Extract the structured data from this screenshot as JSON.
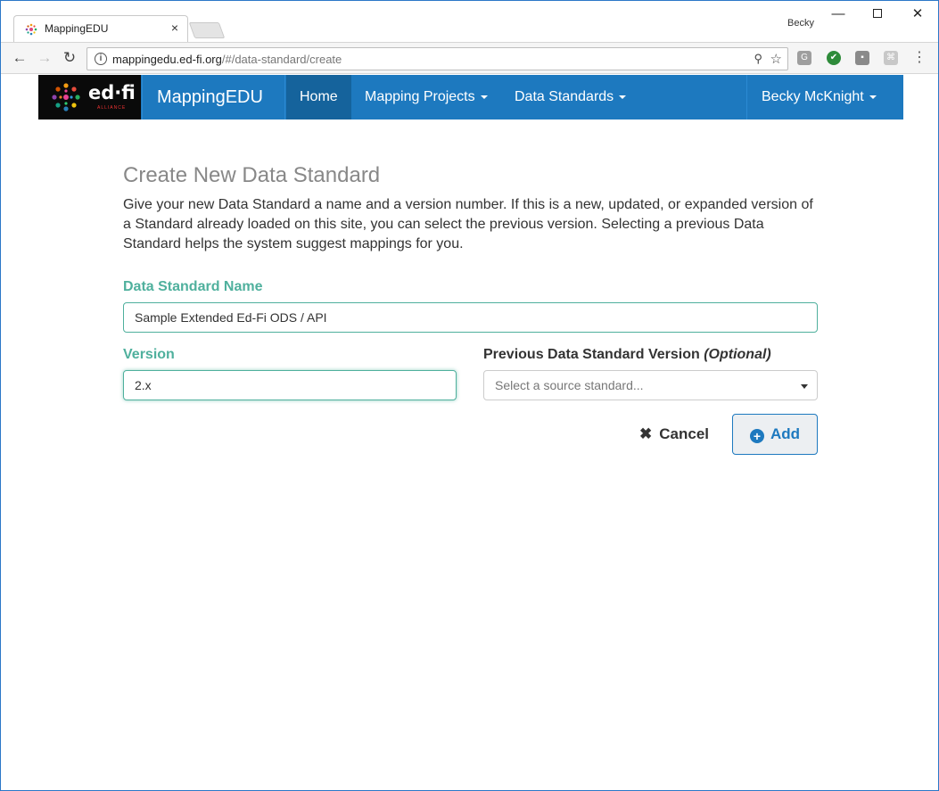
{
  "browser": {
    "tab_title": "MappingEDU",
    "tab_close": "×",
    "profile_name": "Becky",
    "url_host": "mappingedu.ed-fi.org",
    "url_path": "/#/data-standard/create",
    "extensions": [
      "G",
      "✔",
      "▪",
      "⌘"
    ]
  },
  "navbar": {
    "logo_text": "ed·fi",
    "logo_sub": "ALLIANCE",
    "brand": "MappingEDU",
    "home": "Home",
    "mapping_projects": "Mapping Projects",
    "data_standards": "Data Standards",
    "user": "Becky McKnight"
  },
  "page": {
    "title": "Create New Data Standard",
    "intro": "Give your new Data Standard a name and a version number. If this is a new, updated, or expanded version of a Standard already loaded on this site, you can select the previous version. Selecting a previous Data Standard helps the system suggest mappings for you."
  },
  "form": {
    "name_label": "Data Standard Name",
    "name_value": "Sample Extended Ed-Fi ODS / API",
    "version_label": "Version",
    "version_value": "2.x",
    "prev_label": "Previous Data Standard Version ",
    "prev_optional": "(Optional)",
    "prev_placeholder": "Select a source standard..."
  },
  "actions": {
    "cancel": "Cancel",
    "add": "Add"
  },
  "colors": {
    "navbar": "#1d79bf",
    "nav_active": "#15639c",
    "label_teal": "#4fb09d"
  }
}
